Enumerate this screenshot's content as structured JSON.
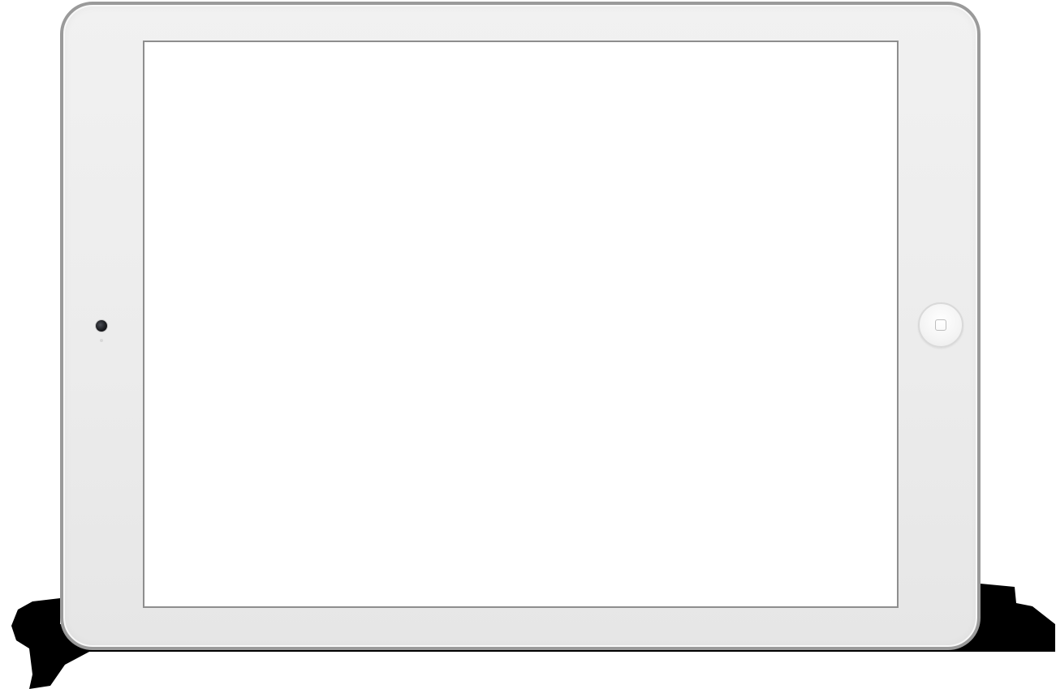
{
  "device": {
    "kind": "tablet",
    "orientation": "landscape",
    "bezel_color": "#ececec",
    "edge_color": "#9a9a9a",
    "screen_color": "#ffffff",
    "shadow_color": "#000000"
  },
  "icons": {
    "camera": "front-camera-icon",
    "home_button": "home-button-icon"
  }
}
